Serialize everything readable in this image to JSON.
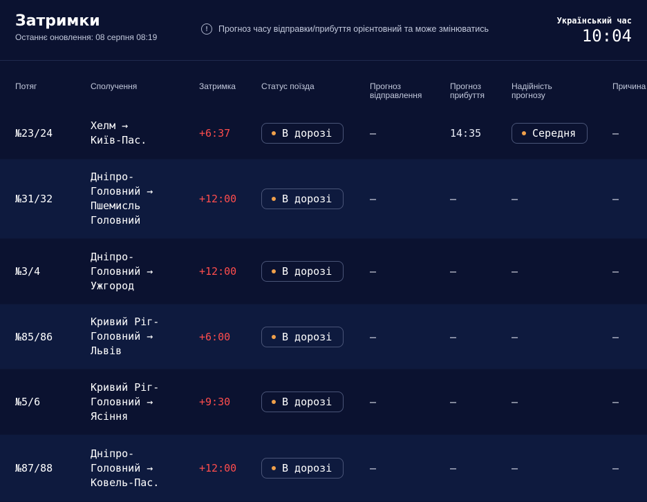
{
  "header": {
    "title": "Затримки",
    "updated": "Останнє оновлення: 08 серпня 08:19",
    "notice": "Прогноз часу відправки/прибуття орієнтовний та може змінюватись",
    "clock_label": "Український час",
    "clock_time": "10:04"
  },
  "columns": {
    "train": "Потяг",
    "route": "Сполучення",
    "delay": "Затримка",
    "status": "Статус поїзда",
    "departure": "Прогноз відправлення",
    "arrival": "Прогноз прибуття",
    "reliability": "Надійність прогнозу",
    "reason": "Причина"
  },
  "rows": [
    {
      "train": "№23/24",
      "route": [
        "Хелм →",
        "Київ-Пас."
      ],
      "delay": "+6:37",
      "status": "В дорозі",
      "departure": "—",
      "arrival": "14:35",
      "reliability": "Середня",
      "reason": "—"
    },
    {
      "train": "№31/32",
      "route": [
        "Дніпро-",
        "Головний →",
        "Пшемисль",
        "Головний"
      ],
      "delay": "+12:00",
      "status": "В дорозі",
      "departure": "—",
      "arrival": "—",
      "reliability": "—",
      "reason": "—"
    },
    {
      "train": "№3/4",
      "route": [
        "Дніпро-",
        "Головний →",
        "Ужгород"
      ],
      "delay": "+12:00",
      "status": "В дорозі",
      "departure": "—",
      "arrival": "—",
      "reliability": "—",
      "reason": "—"
    },
    {
      "train": "№85/86",
      "route": [
        "Кривий Ріг-",
        "Головний →",
        "Львів"
      ],
      "delay": "+6:00",
      "status": "В дорозі",
      "departure": "—",
      "arrival": "—",
      "reliability": "—",
      "reason": "—"
    },
    {
      "train": "№5/6",
      "route": [
        "Кривий Ріг-",
        "Головний →",
        "Ясіння"
      ],
      "delay": "+9:30",
      "status": "В дорозі",
      "departure": "—",
      "arrival": "—",
      "reliability": "—",
      "reason": "—"
    },
    {
      "train": "№87/88",
      "route": [
        "Дніпро-",
        "Головний →",
        "Ковель-Пас."
      ],
      "delay": "+12:00",
      "status": "В дорозі",
      "departure": "—",
      "arrival": "—",
      "reliability": "—",
      "reason": "—"
    }
  ],
  "colors": {
    "background": "#0b1230",
    "delay": "#ff4d4d",
    "status_dot": "#f0a04b"
  },
  "icons": {
    "notice": "info-icon"
  }
}
